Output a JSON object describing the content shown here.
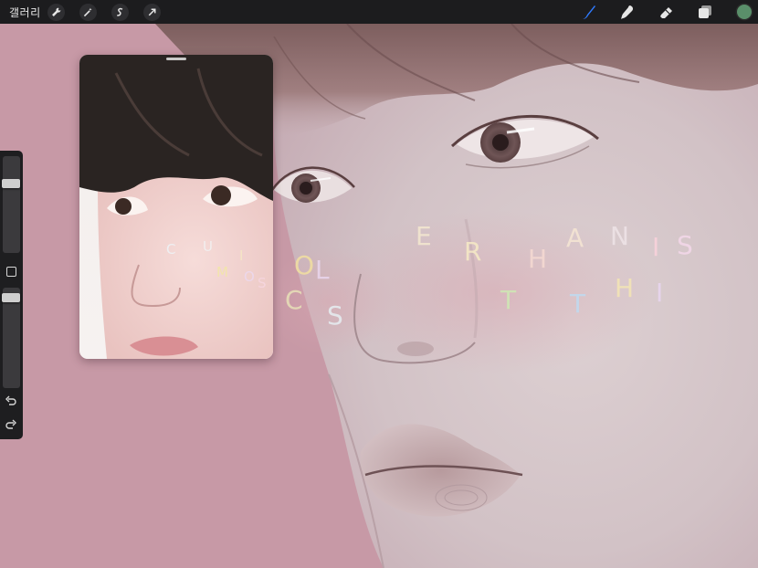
{
  "app": {
    "gallery_label": "갤러리"
  },
  "toolbar": {
    "left_tools": [
      {
        "name": "actions",
        "icon": "wrench-icon"
      },
      {
        "name": "adjustments",
        "icon": "magic-wand-icon"
      },
      {
        "name": "selection",
        "icon": "selection-s-icon"
      },
      {
        "name": "transform",
        "icon": "arrow-cursor-icon"
      }
    ],
    "right_tools": [
      {
        "name": "brush",
        "icon": "brush-icon",
        "active": true
      },
      {
        "name": "smudge",
        "icon": "smudge-icon"
      },
      {
        "name": "eraser",
        "icon": "eraser-icon"
      },
      {
        "name": "layers",
        "icon": "layers-icon"
      }
    ],
    "current_color": "#5a8f6a",
    "active_color": "#2f7bff"
  },
  "sidebar": {
    "brush_size": 0.85,
    "brush_opacity": 0.9
  },
  "canvas": {
    "background": "#c799a6",
    "letters": [
      "E",
      "R",
      "H",
      "A",
      "N",
      "I",
      "S",
      "T",
      "T",
      "H",
      "I",
      "C",
      "O",
      "L",
      "S"
    ]
  },
  "reference": {
    "letters": [
      "U",
      "I",
      "M",
      "O",
      "C",
      "S"
    ]
  }
}
